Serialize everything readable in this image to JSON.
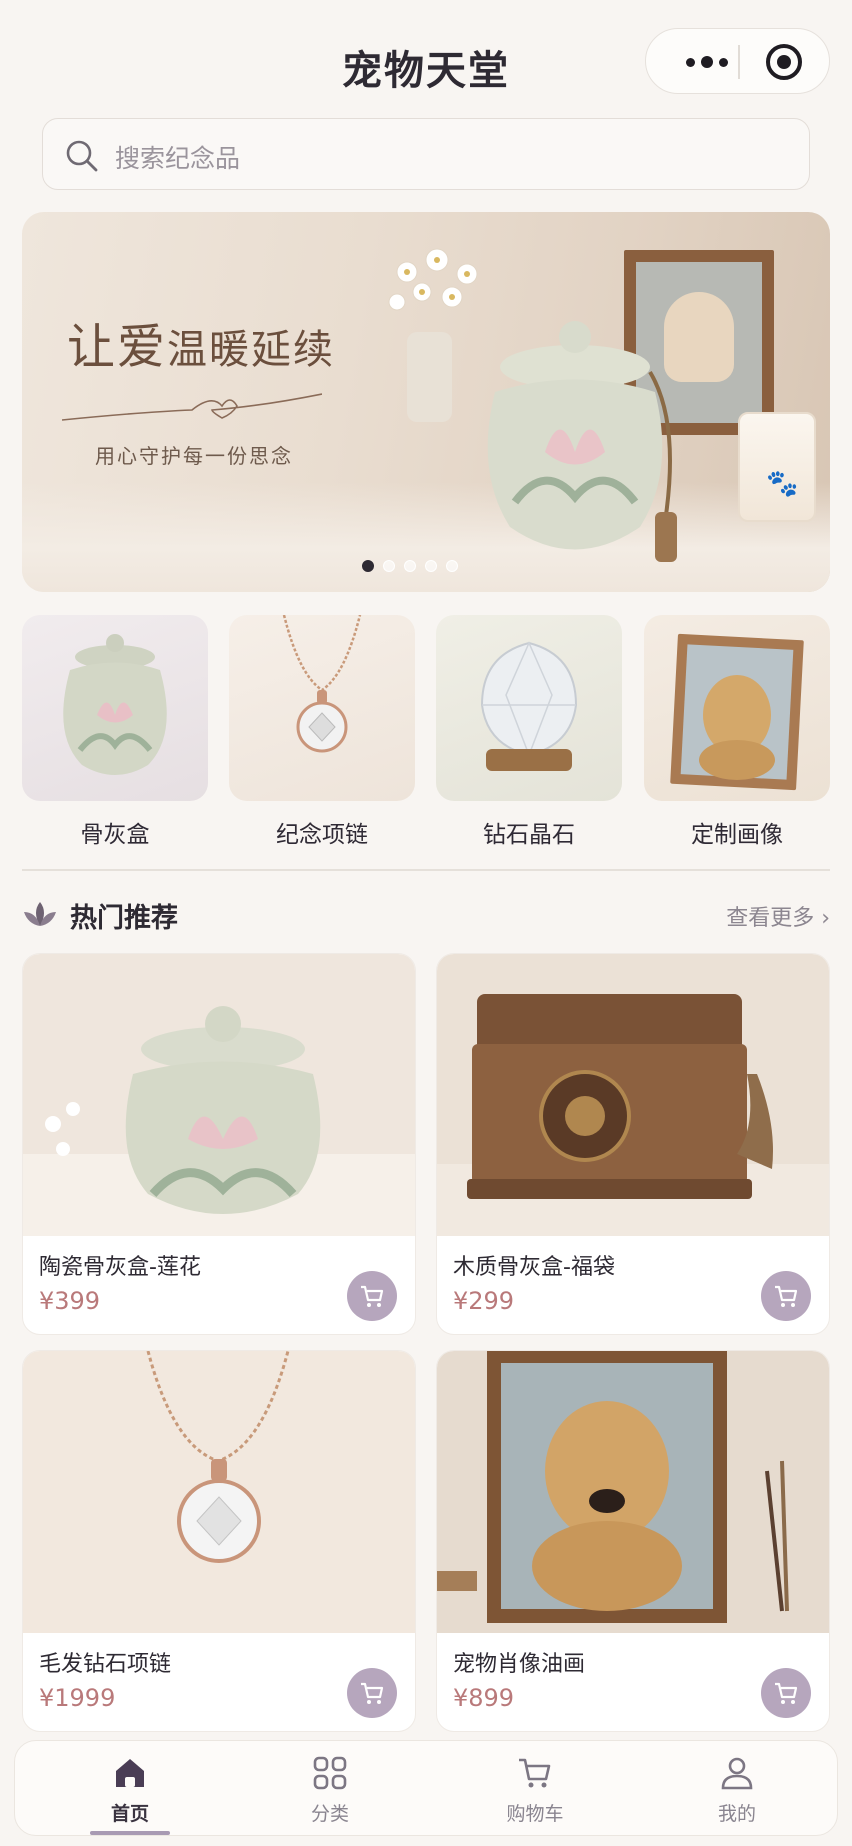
{
  "header": {
    "title": "宠物天堂"
  },
  "search": {
    "placeholder": "搜索纪念品"
  },
  "banner": {
    "slogan_a": "让爱",
    "slogan_b": "温暖延续",
    "subtitle": "用心守护每一份思念",
    "slide_count": 5,
    "active_slide": 1
  },
  "categories": [
    {
      "label": "骨灰盒",
      "icon": "urn"
    },
    {
      "label": "纪念项链",
      "icon": "necklace"
    },
    {
      "label": "钻石晶石",
      "icon": "crystal"
    },
    {
      "label": "定制画像",
      "icon": "portrait"
    }
  ],
  "section": {
    "title": "热门推荐",
    "more": "查看更多 ›"
  },
  "products": [
    {
      "name": "陶瓷骨灰盒-莲花",
      "price": "¥399"
    },
    {
      "name": "木质骨灰盒-福袋",
      "price": "¥299"
    },
    {
      "name": "毛发钻石项链",
      "price": "¥1999"
    },
    {
      "name": "宠物肖像油画",
      "price": "¥899"
    }
  ],
  "tabs": [
    {
      "label": "首页",
      "icon": "home-icon",
      "active": true
    },
    {
      "label": "分类",
      "icon": "grid-icon",
      "active": false
    },
    {
      "label": "购物车",
      "icon": "cart-icon",
      "active": false
    },
    {
      "label": "我的",
      "icon": "user-icon",
      "active": false
    }
  ],
  "colors": {
    "accent": "#b6a6bd",
    "price": "#b9797a",
    "brand_dark": "#2e2a33"
  }
}
